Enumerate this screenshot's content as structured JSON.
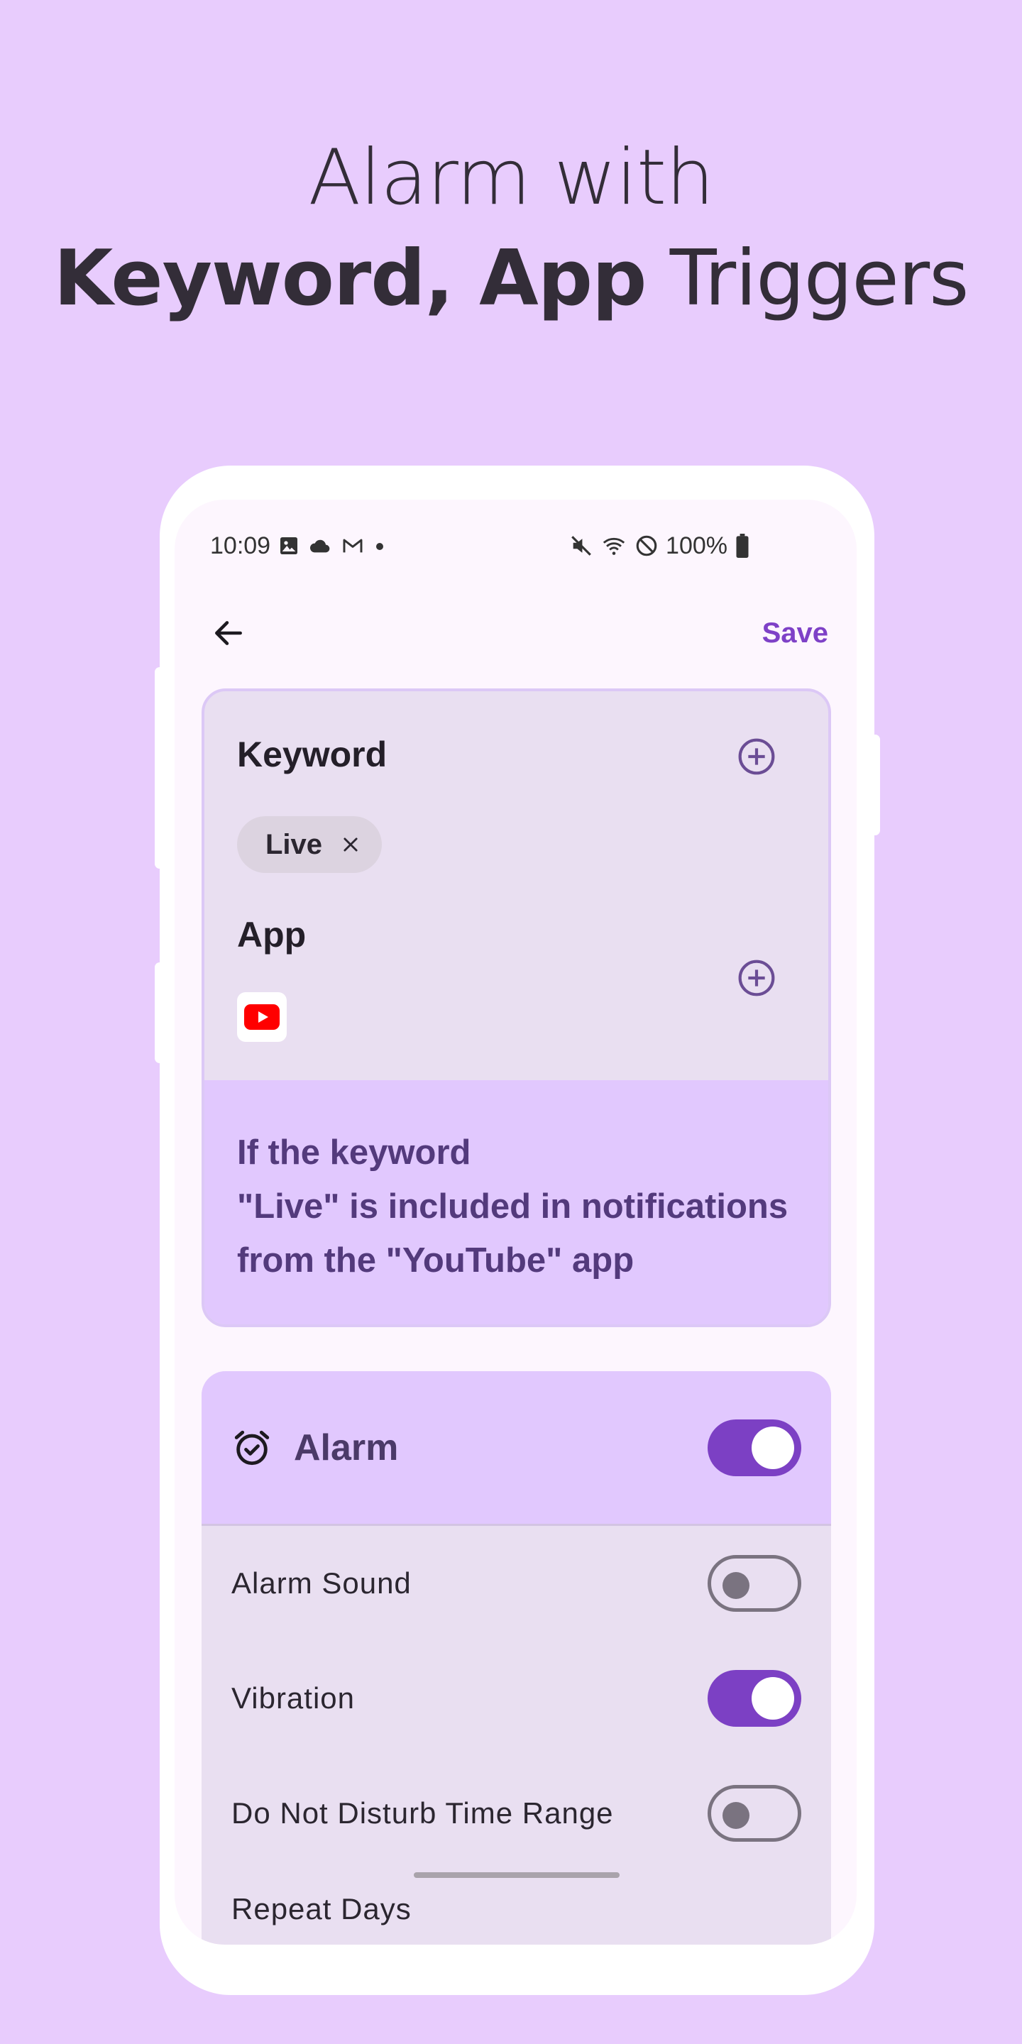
{
  "headline": {
    "line1": "Alarm with",
    "line2_bold": "Keyword, App",
    "line2_rest": " Triggers"
  },
  "status_bar": {
    "time": "10:09",
    "left_icons": [
      "image-icon",
      "cloud-icon",
      "gmail-icon",
      "dot-icon"
    ],
    "right_icons": [
      "mute-icon",
      "wifi-icon",
      "dnd-icon"
    ],
    "battery": "100%"
  },
  "topbar": {
    "back_icon": "arrow-left-icon",
    "save_label": "Save"
  },
  "trigger_card": {
    "keyword_title": "Keyword",
    "keyword_chip": "Live",
    "app_title": "App",
    "app_icon": "youtube-icon",
    "description_line1": "If the keyword",
    "description_line2": "\"Live\" is included in notifications",
    "description_line3": "from the \"YouTube\" app"
  },
  "alarm_card": {
    "title": "Alarm",
    "enabled": true,
    "settings": [
      {
        "label": "Alarm Sound",
        "on": false
      },
      {
        "label": "Vibration",
        "on": true
      },
      {
        "label": "Do Not Disturb Time Range",
        "on": false
      }
    ],
    "repeat_label": "Repeat Days"
  },
  "colors": {
    "background": "#e8ccfd",
    "accent": "#7c40c4",
    "card": "#e9dff1",
    "highlight": "#e1c8fe"
  }
}
